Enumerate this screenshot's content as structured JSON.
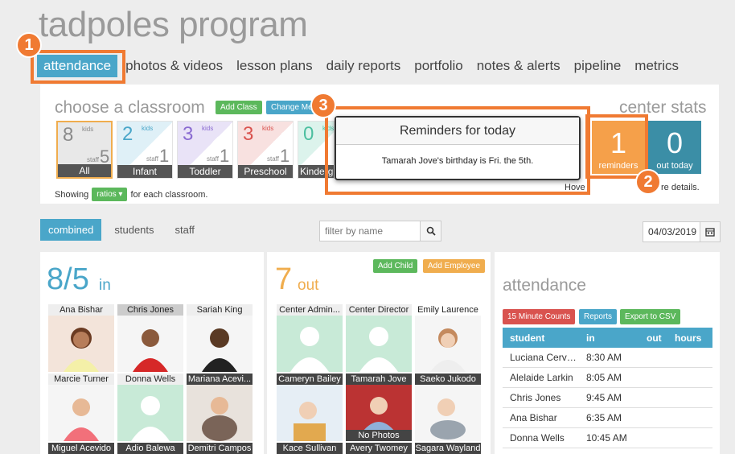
{
  "app": {
    "title": "tadpoles program"
  },
  "nav": [
    {
      "label": "attendance",
      "active": true
    },
    {
      "label": "photos & videos"
    },
    {
      "label": "lesson plans"
    },
    {
      "label": "daily reports"
    },
    {
      "label": "portfolio"
    },
    {
      "label": "notes & alerts"
    },
    {
      "label": "pipeline"
    },
    {
      "label": "metrics"
    }
  ],
  "callouts": {
    "one": "1",
    "two": "2",
    "three": "3"
  },
  "classroom": {
    "title": "choose a classroom",
    "add_class": "Add Class",
    "change_me": "Change Me",
    "tiles": [
      {
        "kids": "8",
        "staff": "5",
        "label": "All",
        "color": "#8a8a8a"
      },
      {
        "kids": "2",
        "staff": "1",
        "label": "Infant",
        "color": "#4aa6c9"
      },
      {
        "kids": "3",
        "staff": "1",
        "label": "Toddler",
        "color": "#8a6bd1"
      },
      {
        "kids": "3",
        "staff": "1",
        "label": "Preschool",
        "color": "#d9534f"
      },
      {
        "kids": "0",
        "staff": "",
        "label": "Kinderg",
        "color": "#4cbfa0"
      }
    ],
    "kids_word": "kids",
    "staff_word": "staff",
    "showing_prefix": "Showing",
    "ratios": "ratios ▾",
    "showing_suffix": "for each classroom."
  },
  "center_stats": {
    "title": "center stats",
    "reminders_count": "1",
    "reminders_label": "reminders",
    "out_count": "0",
    "out_label": "out today",
    "hint_left": "Hove",
    "hint_right": "re details."
  },
  "popup": {
    "title": "Reminders for today",
    "message": "Tamarah Jove's birthday is Fri. the 5th."
  },
  "view_tabs": [
    {
      "label": "combined",
      "active": true
    },
    {
      "label": "students"
    },
    {
      "label": "staff"
    }
  ],
  "filter": {
    "placeholder": "filter by name",
    "date": "04/03/2019"
  },
  "in_panel": {
    "count": "8/5",
    "label": "in",
    "people": [
      {
        "name": "Ana Bishar"
      },
      {
        "name": "Chris Jones"
      },
      {
        "name": "Sariah King"
      },
      {
        "name": "Marcie Turner"
      },
      {
        "name": "Donna Wells"
      },
      {
        "name": "Mariana Acevi..."
      },
      {
        "name": "Miguel Acevido"
      },
      {
        "name": "Adio Balewa"
      },
      {
        "name": "Demitri Campos"
      }
    ]
  },
  "out_panel": {
    "count": "7",
    "label": "out",
    "add_child": "Add Child",
    "add_employee": "Add Employee",
    "people": [
      {
        "name": "Center Admin..."
      },
      {
        "name": "Center Director"
      },
      {
        "name": "Emily Laurence"
      },
      {
        "name": "Cameryn Bailey"
      },
      {
        "name": "Tamarah Jove"
      },
      {
        "name": "Saeko Jukodo"
      },
      {
        "name": "Kace Sullivan"
      },
      {
        "name": "Avery Twomey"
      },
      {
        "name": "Sagara Wayland"
      }
    ],
    "no_photos": "No Photos"
  },
  "attendance_panel": {
    "title": "attendance",
    "btn_15": "15 Minute Counts",
    "btn_reports": "Reports",
    "btn_export": "Export to CSV",
    "columns": [
      "student",
      "in",
      "out",
      "hours"
    ],
    "rows": [
      {
        "student": "Luciana Cerv…",
        "in": "8:30 AM"
      },
      {
        "student": "Alelaide Larkin",
        "in": "8:05 AM"
      },
      {
        "student": "Chris Jones",
        "in": "9:45 AM"
      },
      {
        "student": "Ana Bishar",
        "in": "6:35 AM"
      },
      {
        "student": "Donna Wells",
        "in": "10:45 AM"
      }
    ]
  }
}
